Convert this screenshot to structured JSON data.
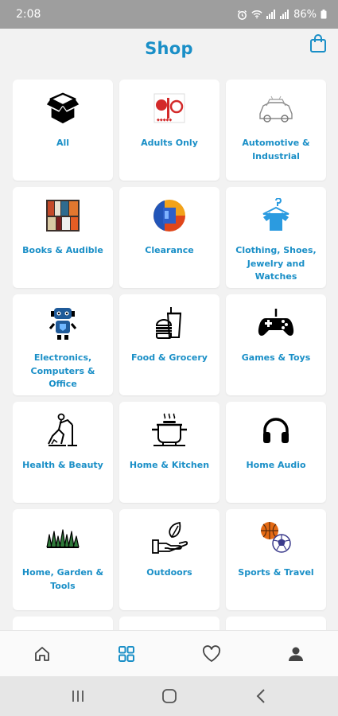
{
  "status_bar": {
    "time": "2:08",
    "battery": "86%"
  },
  "header": {
    "title": "Shop"
  },
  "colors": {
    "accent": "#1a8fc7",
    "background": "#f2f2f2",
    "tile": "#ffffff",
    "status_bar": "#9e9e9e"
  },
  "categories": [
    {
      "label": "All",
      "icon": "open-box-icon"
    },
    {
      "label": "Adults Only",
      "icon": "adults-logo-icon"
    },
    {
      "label": "Automotive & Industrial",
      "icon": "car-icon"
    },
    {
      "label": "Books & Audible",
      "icon": "books-icon"
    },
    {
      "label": "Clearance",
      "icon": "clearance-badge-icon"
    },
    {
      "label": "Clothing, Shoes, Jewelry and Watches",
      "icon": "shirt-on-hanger-icon"
    },
    {
      "label": "Electronics, Computers & Office",
      "icon": "robot-icon"
    },
    {
      "label": "Food & Grocery",
      "icon": "drink-and-burger-icon"
    },
    {
      "label": "Games & Toys",
      "icon": "gamepad-icon"
    },
    {
      "label": "Health & Beauty",
      "icon": "exercise-icon"
    },
    {
      "label": "Home & Kitchen",
      "icon": "cooking-pot-icon"
    },
    {
      "label": "Home Audio",
      "icon": "headphones-icon"
    },
    {
      "label": "Home, Garden & Tools",
      "icon": "grass-icon"
    },
    {
      "label": "Outdoors",
      "icon": "leaf-in-hand-icon"
    },
    {
      "label": "Sports & Travel",
      "icon": "balls-icon"
    },
    {
      "label": "",
      "icon": "partial-icon"
    },
    {
      "label": "",
      "icon": "partial-icon"
    },
    {
      "label": "",
      "icon": "partial-icon"
    }
  ],
  "bottom_nav": [
    {
      "name": "home",
      "icon": "home-icon",
      "active": false
    },
    {
      "name": "categories",
      "icon": "grid-icon",
      "active": true
    },
    {
      "name": "favorites",
      "icon": "heart-icon",
      "active": false
    },
    {
      "name": "account",
      "icon": "person-icon",
      "active": false
    }
  ],
  "system_nav": [
    {
      "name": "recents",
      "icon": "recents-icon"
    },
    {
      "name": "home",
      "icon": "circle-home-icon"
    },
    {
      "name": "back",
      "icon": "back-chevron-icon"
    }
  ]
}
